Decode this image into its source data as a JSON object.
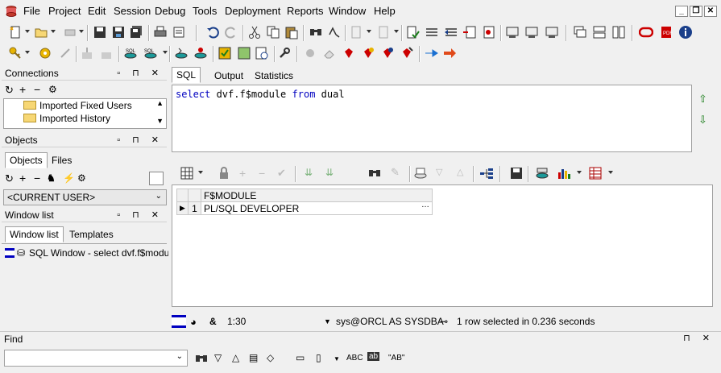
{
  "menubar": {
    "items": [
      "File",
      "Project",
      "Edit",
      "Session",
      "Debug",
      "Tools",
      "Deployment",
      "Reports",
      "Window",
      "Help"
    ]
  },
  "connections": {
    "title": "Connections",
    "tree_items": [
      "Imported Fixed Users",
      "Imported History"
    ]
  },
  "objects": {
    "title": "Objects",
    "tabs": [
      "Objects",
      "Files"
    ],
    "user_select": "<CURRENT USER>"
  },
  "window_list": {
    "title": "Window list",
    "tabs": [
      "Window list",
      "Templates"
    ],
    "items": [
      "SQL Window - select dvf.f$module from dual"
    ]
  },
  "sql_window": {
    "tabs": [
      "SQL",
      "Output",
      "Statistics"
    ],
    "active_tab": "SQL",
    "query": {
      "kw1": "select",
      "mid": " dvf.f$module ",
      "kw2": "from",
      "tail": " dual"
    }
  },
  "result_grid": {
    "columns": [
      "F$MODULE"
    ],
    "rows": [
      {
        "num": "1",
        "values": [
          "PL/SQL DEVELOPER"
        ]
      }
    ]
  },
  "statusbar": {
    "cursor_pos": "1:30",
    "connection": "sys@ORCL AS SYSDBA",
    "message": "1 row selected in 0.236 seconds",
    "ampersand": "&"
  },
  "find": {
    "title": "Find",
    "input_value": "",
    "options": [
      "ABC",
      "\"AB\""
    ]
  },
  "colors": {
    "keyword": "#0000c0",
    "background": "#f0f0f0"
  }
}
